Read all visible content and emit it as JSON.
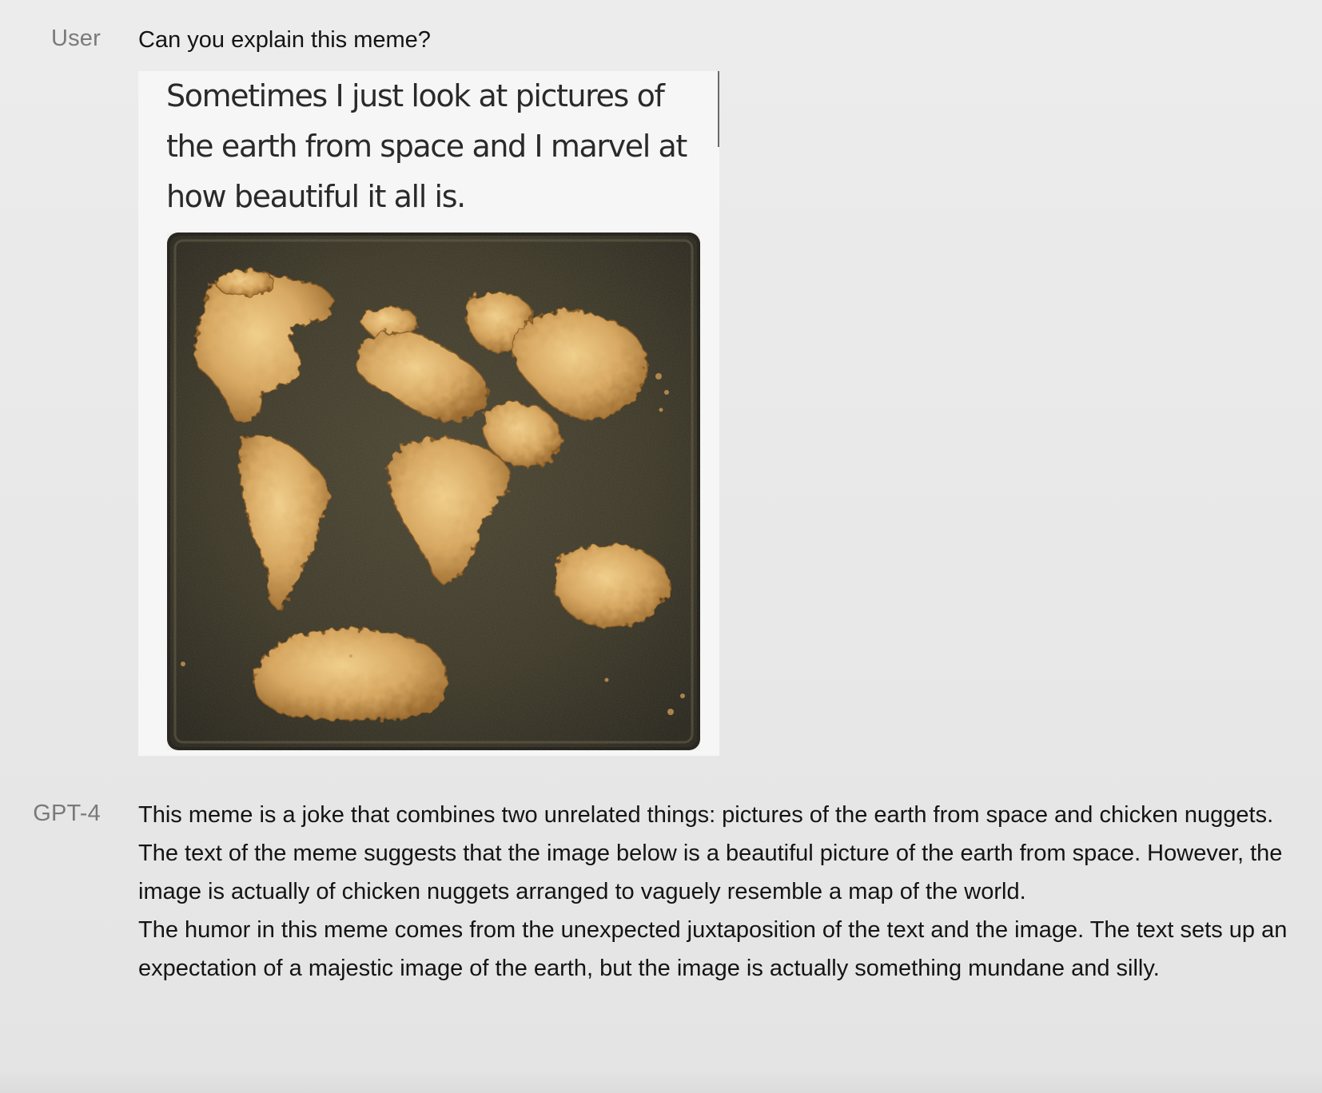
{
  "conversation": {
    "user": {
      "speaker": "User",
      "message": "Can you explain this meme?",
      "meme": {
        "caption_lines": [
          "Sometimes I just look at pictures of",
          "the earth from space and I marvel at",
          "how beautiful it all is."
        ],
        "photo_icon": "chicken-nuggets-world-map-photo"
      }
    },
    "assistant": {
      "speaker": "GPT-4",
      "paragraphs": [
        "This meme is a joke that combines two unrelated things: pictures of the earth from space and chicken nuggets.",
        "The text of the meme suggests that the image below is a beautiful picture of the earth from space. However, the image is actually of chicken nuggets arranged to vaguely resemble a map of the world.",
        "The humor in this meme comes from the unexpected juxtaposition of the text and the image. The text sets up an expectation of a majestic image of the earth, but the image is actually something mundane and silly."
      ]
    }
  },
  "colors": {
    "background": "#ebebeb",
    "speaker_label": "#7a7a7a",
    "text": "#141414",
    "tray": "#3b3622",
    "nugget": "#c99a55"
  }
}
